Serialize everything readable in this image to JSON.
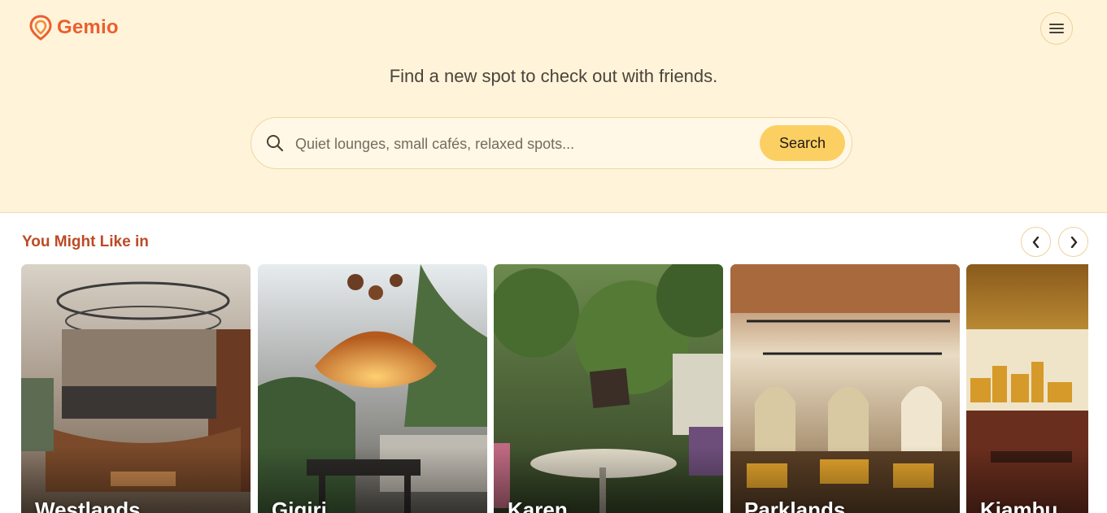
{
  "brand": {
    "name": "Gemio",
    "color": "#ec5f2e"
  },
  "header": {
    "menu_icon": "hamburger-icon"
  },
  "hero": {
    "tagline": "Find a new spot to check out with friends.",
    "search": {
      "placeholder": "Quiet lounges, small cafés, relaxed spots...",
      "value": "",
      "button_label": "Search"
    }
  },
  "section": {
    "title": "You Might Like in",
    "prev_icon": "chevron-left-icon",
    "next_icon": "chevron-right-icon"
  },
  "cards": [
    {
      "label": "Westlands"
    },
    {
      "label": "Gigiri"
    },
    {
      "label": "Karen"
    },
    {
      "label": "Parklands"
    },
    {
      "label": "Kiambu"
    }
  ]
}
